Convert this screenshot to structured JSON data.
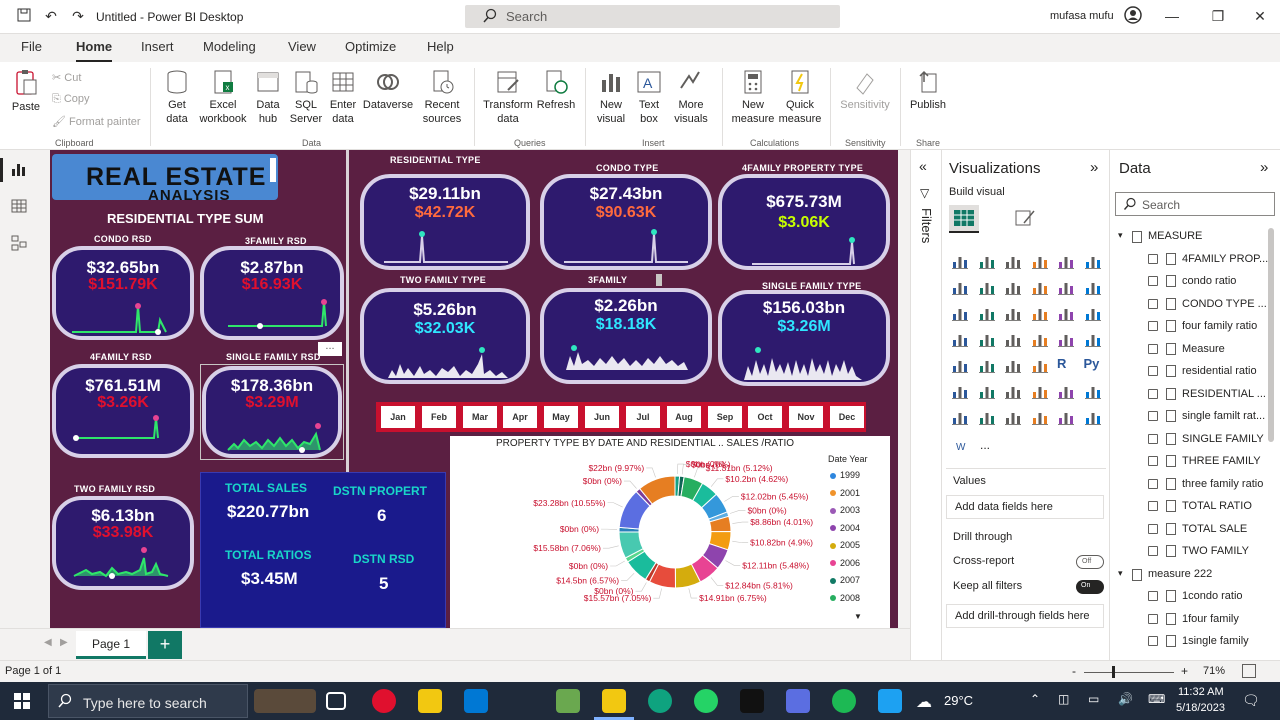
{
  "titlebar": {
    "title": "Untitled - Power BI Desktop",
    "search_placeholder": "Search",
    "user": "mufasa mufu"
  },
  "menu": [
    "File",
    "Home",
    "Insert",
    "Modeling",
    "View",
    "Optimize",
    "Help"
  ],
  "ribbon": {
    "paste": "Paste",
    "cut": "Cut",
    "copy": "Copy",
    "format_painter": "Format painter",
    "get_data": "Get data",
    "excel": "Excel workbook",
    "data_hub": "Data hub",
    "sql": "SQL Server",
    "enter_data": "Enter data",
    "dataverse": "Dataverse",
    "recent_sources": "Recent sources",
    "transform": "Transform data",
    "refresh": "Refresh",
    "new_visual": "New visual",
    "text_box": "Text box",
    "more_visuals": "More visuals",
    "new_measure": "New measure",
    "quick_measure": "Quick measure",
    "sensitivity": "Sensitivity",
    "publish": "Publish",
    "groups": {
      "clipboard": "Clipboard",
      "data": "Data",
      "queries": "Queries",
      "insert": "Insert",
      "calculations": "Calculations",
      "sensitivity": "Sensitivity",
      "share": "Share"
    }
  },
  "report": {
    "title": "REAL ESTATE",
    "subtitle": "ANALYSIS",
    "residential_sum_label": "RESIDENTIAL TYPE SUM",
    "left_cards": [
      {
        "label": "CONDO RSD",
        "value": "$32.65bn",
        "sub": "$151.79K",
        "sub_color": "#e0102e"
      },
      {
        "label": "3FAMILY RSD",
        "value": "$2.87bn",
        "sub": "$16.93K",
        "sub_color": "#e0102e"
      },
      {
        "label": "4FAMILY RSD",
        "value": "$761.51M",
        "sub": "$3.26K",
        "sub_color": "#e0102e"
      },
      {
        "label": "SINGLE FAMILY RSD",
        "value": "$178.36bn",
        "sub": "$3.29M",
        "sub_color": "#e0102e"
      },
      {
        "label": "TWO FAMILY RSD",
        "value": "$6.13bn",
        "sub": "$33.98K",
        "sub_color": "#e0102e"
      }
    ],
    "right_cards": [
      {
        "label": "RESIDENTIAL TYPE",
        "value": "$29.11bn",
        "sub": "$42.72K",
        "sub_color": "#ff6a3d"
      },
      {
        "label": "CONDO TYPE",
        "value": "$27.43bn",
        "sub": "$90.63K",
        "sub_color": "#ff6a3d"
      },
      {
        "label": "4FAMILY PROPERTY TYPE",
        "value": "$675.73M",
        "sub": "$3.06K",
        "sub_color": "#c8ff00"
      },
      {
        "label": "TWO FAMILY TYPE",
        "value": "$5.26bn",
        "sub": "$32.03K",
        "sub_color": "#2fe6ff"
      },
      {
        "label": "3FAMILY",
        "value": "$2.26bn",
        "sub": "$18.18K",
        "sub_color": "#2fe6ff"
      },
      {
        "label": "SINGLE FAMILY TYPE",
        "value": "$156.03bn",
        "sub": "$3.26M",
        "sub_color": "#2fe6ff"
      }
    ],
    "months": [
      "Jan",
      "Feb",
      "Mar",
      "Apr",
      "May",
      "Jun",
      "Jul",
      "Aug",
      "Sep",
      "Oct",
      "Nov",
      "Dec"
    ],
    "totals": {
      "total_sales_label": "TOTAL SALES",
      "total_sales": "$220.77bn",
      "dstn_propert_label": "DSTN PROPERT",
      "dstn_propert": "6",
      "total_ratios_label": "TOTAL RATIOS",
      "total_ratios": "$3.45M",
      "dstn_rsd_label": "DSTN RSD",
      "dstn_rsd": "5"
    },
    "more_options": "..."
  },
  "chart_data": {
    "type": "pie",
    "title": "PROPERTY TYPE BY DATE AND RESIDENTIAL .. SALES /RATIO",
    "legend_title": "Date Year",
    "legend": [
      "1999",
      "2001",
      "2003",
      "2004",
      "2005",
      "2006",
      "2007",
      "2008"
    ],
    "legend_colors": [
      "#2e86de",
      "#f0932b",
      "#9b59b6",
      "#8e44ad",
      "#d4ac0d",
      "#e84393",
      "#117a65",
      "#27ae60"
    ],
    "slices": [
      {
        "label": "$0bn (0%)",
        "value": 0
      },
      {
        "label": "$0bn (0%)",
        "value": 0
      },
      {
        "label": "$11.31bn (5.12%)",
        "value": 5.12
      },
      {
        "label": "$10.2bn (4.62%)",
        "value": 4.62
      },
      {
        "label": "$12.02bn (5.45%)",
        "value": 5.45
      },
      {
        "label": "$0bn (0%)",
        "value": 0
      },
      {
        "label": "$8.86bn (4.01%)",
        "value": 4.01
      },
      {
        "label": "$10.82bn (4.9%)",
        "value": 4.9
      },
      {
        "label": "$12.11bn (5.48%)",
        "value": 5.48
      },
      {
        "label": "$12.84bn (5.81%)",
        "value": 5.81
      },
      {
        "label": "$14.91bn (6.75%)",
        "value": 6.75
      },
      {
        "label": "$15.57bn (7.05%)",
        "value": 7.05
      },
      {
        "label": "$0bn (0%)",
        "value": 0
      },
      {
        "label": "$14.5bn (6.57%)",
        "value": 6.57
      },
      {
        "label": "$0bn (0%)",
        "value": 0
      },
      {
        "label": "$15.58bn (7.06%)",
        "value": 7.06
      },
      {
        "label": "$0bn (0%)",
        "value": 0
      },
      {
        "label": "$23.28bn (10.55%)",
        "value": 10.55
      },
      {
        "label": "$0bn (0%)",
        "value": 0
      },
      {
        "label": "$22bn (9.97%)",
        "value": 9.97
      }
    ],
    "slice_colors": [
      "#16a085",
      "#0e6655",
      "#27ae60",
      "#1abc9c",
      "#3498db",
      "#5dade2",
      "#e67e22",
      "#f39c12",
      "#8e44ad",
      "#e84393",
      "#d4ac0d",
      "#e74c3c",
      "#c0392b",
      "#1abc9c",
      "#58d68d",
      "#48c9b0",
      "#2980b9",
      "#5b6ee1",
      "#7d3c98",
      "#e67e22"
    ]
  },
  "pages": {
    "tab": "Page 1",
    "add": "+"
  },
  "status": {
    "page": "Page 1 of 1",
    "zoom": "71%",
    "minus": "-",
    "plus": "+"
  },
  "filters": {
    "label": "Filters"
  },
  "visualizations": {
    "title": "Visualizations",
    "build_visual": "Build visual",
    "values": "Values",
    "add_data_fields": "Add data fields here",
    "drill_through": "Drill through",
    "cross_report": "Cross-report",
    "cross_report_state": "Off",
    "keep_all_filters": "Keep all filters",
    "keep_all_filters_state": "On",
    "add_drill_through": "Add drill-through fields here",
    "more": "...",
    "py": "Py",
    "r": "R"
  },
  "data_pane": {
    "title": "Data",
    "search_placeholder": "Search",
    "groups": [
      {
        "name": "MEASURE",
        "fields": [
          "4FAMILY PROP...",
          "condo ratio",
          "CONDO TYPE ...",
          "four family ratio",
          "Measure",
          "residential ratio",
          "RESIDENTIAL ...",
          "single familt rat...",
          "SINGLE FAMILY",
          "THREE FAMILY",
          "three family ratio",
          "TOTAL RATIO",
          "TOTAL SALE",
          "TWO FAMILY"
        ]
      },
      {
        "name": "measure 222",
        "fields": [
          "1condo ratio",
          "1four family",
          "1single family"
        ]
      }
    ]
  },
  "taskbar": {
    "search_placeholder": "Type here to search",
    "temperature": "29°C",
    "time": "11:32 AM",
    "date": "5/18/2023"
  }
}
